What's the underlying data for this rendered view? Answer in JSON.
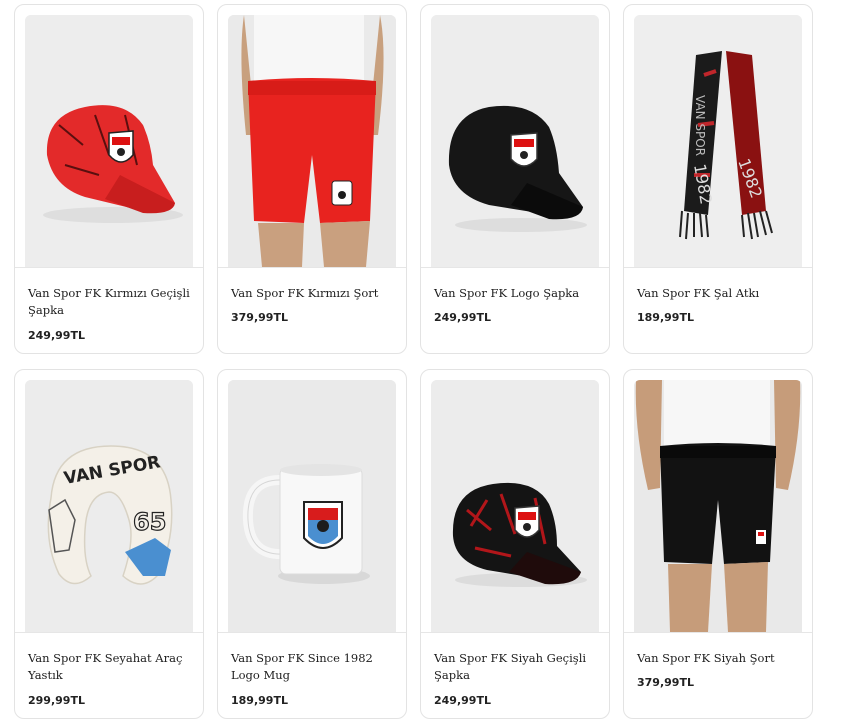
{
  "products": [
    {
      "name": "Van Spor FK Kırmızı Geçişli Şapka",
      "price": "249,99TL",
      "icon": "red-cap-image"
    },
    {
      "name": "Van Spor FK Kırmızı Şort",
      "price": "379,99TL",
      "icon": "red-shorts-image"
    },
    {
      "name": "Van Spor FK Logo Şapka",
      "price": "249,99TL",
      "icon": "black-cap-image"
    },
    {
      "name": "Van Spor FK Şal Atkı",
      "price": "189,99TL",
      "icon": "scarf-image"
    },
    {
      "name": "Van Spor FK Seyahat Araç Yastık",
      "price": "299,99TL",
      "icon": "neck-pillow-image"
    },
    {
      "name": "Van Spor FK Since 1982 Logo Mug",
      "price": "189,99TL",
      "icon": "mug-image"
    },
    {
      "name": "Van Spor FK Siyah Geçişli Şapka",
      "price": "249,99TL",
      "icon": "black-red-cap-image"
    },
    {
      "name": "Van Spor FK Siyah Şort",
      "price": "379,99TL",
      "icon": "black-shorts-image"
    }
  ],
  "images": {
    "scarf_text_a": "VAN SPOR",
    "scarf_year": "1982",
    "pillow_text": "VAN SPOR",
    "pillow_number": "65"
  },
  "colors": {
    "accent_red": "#e3262b",
    "dark": "#141414",
    "blue": "#4a8fd0"
  }
}
